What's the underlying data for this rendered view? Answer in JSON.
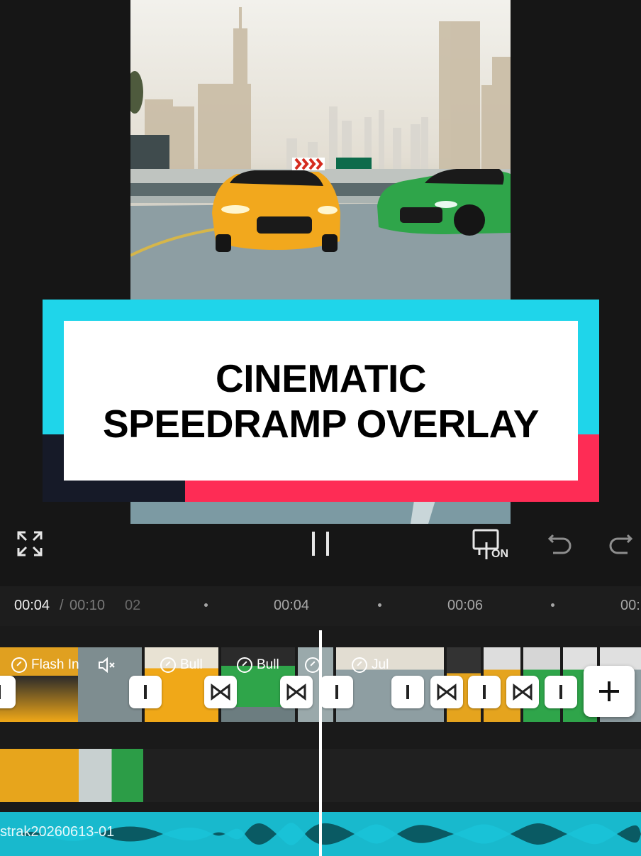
{
  "banner": {
    "line1": "CINEMATIC",
    "line2": "SPEEDRAMP OVERLAY"
  },
  "toolbar": {
    "fullscreen_icon": "fullscreen-icon",
    "pause_icon": "pause-icon",
    "keyframe_toggle_label": "ON",
    "undo_icon": "undo-icon",
    "redo_icon": "redo-icon"
  },
  "ruler": {
    "current_time": "00:04",
    "separator": "/",
    "total_time": "00:10",
    "ticks": [
      "02",
      "00:04",
      "00:06",
      "00:"
    ]
  },
  "main_track": {
    "segments": [
      {
        "label": "Flash In",
        "icon": "speed-icon"
      },
      {
        "label": "",
        "icon": "mute-icon"
      },
      {
        "label": "Bull",
        "icon": "speed-icon"
      },
      {
        "label": "Bull",
        "icon": "speed-icon"
      },
      {
        "label": "",
        "icon": "speed-icon"
      },
      {
        "label": "Jul",
        "icon": "speed-icon"
      }
    ],
    "add_button_icon": "plus-icon"
  },
  "audio_track": {
    "name": "strak20260613-01"
  },
  "colors": {
    "accent_cyan": "#1fd5ea",
    "accent_pink": "#fe2c55",
    "audio_track": "#0a5a63",
    "waveform": "#19c3d8"
  }
}
